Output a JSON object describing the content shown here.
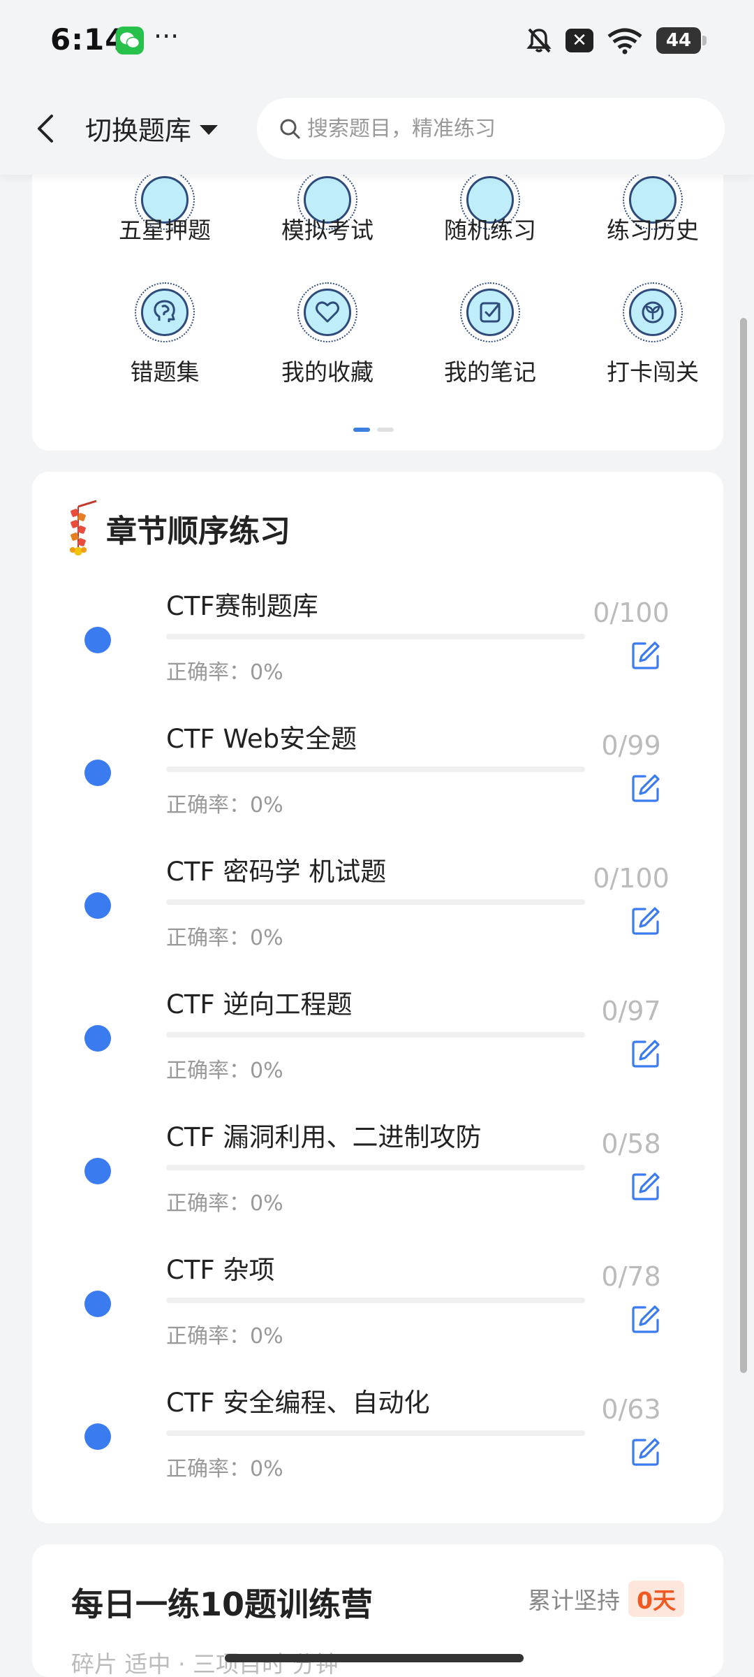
{
  "status_bar": {
    "time": "6:14",
    "more": "···",
    "battery": "44",
    "close_glyph": "✕"
  },
  "header": {
    "switch_label": "切换题库",
    "search_placeholder": "搜索题目，精准练习"
  },
  "grid": {
    "row1": [
      {
        "label": "五星押题",
        "icon": "star-icon"
      },
      {
        "label": "模拟考试",
        "icon": "exam-icon"
      },
      {
        "label": "随机练习",
        "icon": "random-icon"
      },
      {
        "label": "练习历史",
        "icon": "history-icon"
      }
    ],
    "row2": [
      {
        "label": "错题集",
        "icon": "brain-icon"
      },
      {
        "label": "我的收藏",
        "icon": "heart-icon"
      },
      {
        "label": "我的笔记",
        "icon": "note-icon"
      },
      {
        "label": "打卡闯关",
        "icon": "sprout-icon"
      }
    ],
    "page_count": 2,
    "active_page": 0
  },
  "chapters": {
    "title": "章节顺序练习",
    "items": [
      {
        "name": "CTF赛制题库",
        "accuracy": "正确率：0%",
        "count": "0/100",
        "progress": 0
      },
      {
        "name": "CTF Web安全题",
        "accuracy": "正确率：0%",
        "count": "0/99",
        "progress": 0
      },
      {
        "name": "CTF 密码学 机试题",
        "accuracy": "正确率：0%",
        "count": "0/100",
        "progress": 0
      },
      {
        "name": "CTF 逆向工程题",
        "accuracy": "正确率：0%",
        "count": "0/97",
        "progress": 0
      },
      {
        "name": "CTF 漏洞利用、二进制攻防",
        "accuracy": "正确率：0%",
        "count": "0/58",
        "progress": 0
      },
      {
        "name": "CTF 杂项",
        "accuracy": "正确率：0%",
        "count": "0/78",
        "progress": 0
      },
      {
        "name": "CTF 安全编程、自动化",
        "accuracy": "正确率：0%",
        "count": "0/63",
        "progress": 0
      }
    ]
  },
  "camp": {
    "title": "每日一练10题训练营",
    "streak_label": "累计坚持",
    "streak_value": "0天",
    "subtitle": "碎片 适中 · 三项目时 分钟"
  },
  "colors": {
    "accent": "#3b7bf0",
    "icon_fill": "#bfeefa",
    "icon_stroke": "#2f4b7c",
    "streak": "#f05a22"
  }
}
